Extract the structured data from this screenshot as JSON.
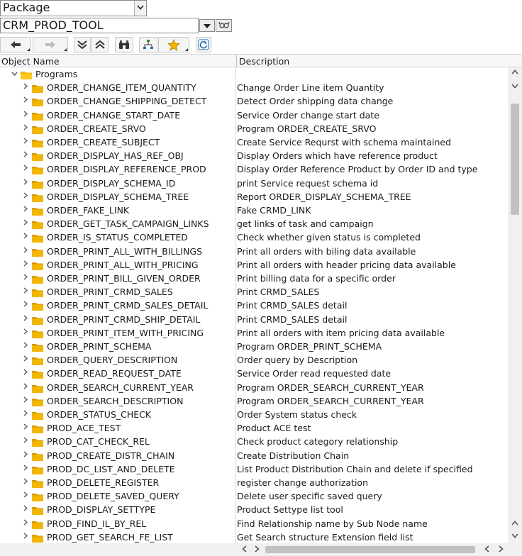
{
  "selector": {
    "type_value": "Package",
    "object_value": "CRM_PROD_TOOL"
  },
  "header": {
    "col1": "Object Name",
    "col2": "Description"
  },
  "tree": {
    "root": {
      "label": "Programs"
    },
    "items": [
      {
        "name": "ORDER_CHANGE_ITEM_QUANTITY",
        "desc": "Change Order Line item Quantity"
      },
      {
        "name": "ORDER_CHANGE_SHIPPING_DETECT",
        "desc": "Detect Order shipping data change"
      },
      {
        "name": "ORDER_CHANGE_START_DATE",
        "desc": "Service Order change start date"
      },
      {
        "name": "ORDER_CREATE_SRVO",
        "desc": "Program ORDER_CREATE_SRVO"
      },
      {
        "name": "ORDER_CREATE_SUBJECT",
        "desc": "Create Service Requrst with schema maintained"
      },
      {
        "name": "ORDER_DISPLAY_HAS_REF_OBJ",
        "desc": "Display Orders which have reference product"
      },
      {
        "name": "ORDER_DISPLAY_REFERENCE_PROD",
        "desc": "Display Order Reference Product by Order ID and type"
      },
      {
        "name": "ORDER_DISPLAY_SCHEMA_ID",
        "desc": "print Service request schema id"
      },
      {
        "name": "ORDER_DISPLAY_SCHEMA_TREE",
        "desc": "Report ORDER_DISPLAY_SCHEMA_TREE"
      },
      {
        "name": "ORDER_FAKE_LINK",
        "desc": "Fake CRMD_LINK"
      },
      {
        "name": "ORDER_GET_TASK_CAMPAIGN_LINKS",
        "desc": "get links of task and campaign"
      },
      {
        "name": "ORDER_IS_STATUS_COMPLETED",
        "desc": "Check whether given status is completed"
      },
      {
        "name": "ORDER_PRINT_ALL_WITH_BILLINGS",
        "desc": "Print all orders with biling data available"
      },
      {
        "name": "ORDER_PRINT_ALL_WITH_PRICING",
        "desc": "Print all orders with header pricing data available"
      },
      {
        "name": "ORDER_PRINT_BILL_GIVEN_ORDER",
        "desc": "Print billing data for a specific order"
      },
      {
        "name": "ORDER_PRINT_CRMD_SALES",
        "desc": "Print CRMD_SALES"
      },
      {
        "name": "ORDER_PRINT_CRMD_SALES_DETAIL",
        "desc": "Print CRMD_SALES detail"
      },
      {
        "name": "ORDER_PRINT_CRMD_SHIP_DETAIL",
        "desc": "Print CRMD_SALES detail"
      },
      {
        "name": "ORDER_PRINT_ITEM_WITH_PRICING",
        "desc": "Print all orders with item pricing data available"
      },
      {
        "name": "ORDER_PRINT_SCHEMA",
        "desc": "Program ORDER_PRINT_SCHEMA"
      },
      {
        "name": "ORDER_QUERY_DESCRIPTION",
        "desc": "Order query by Description"
      },
      {
        "name": "ORDER_READ_REQUEST_DATE",
        "desc": "Service Order read requested date"
      },
      {
        "name": "ORDER_SEARCH_CURRENT_YEAR",
        "desc": "Program ORDER_SEARCH_CURRENT_YEAR"
      },
      {
        "name": "ORDER_SEARCH_DESCRIPTION",
        "desc": "Program ORDER_SEARCH_CURRENT_YEAR"
      },
      {
        "name": "ORDER_STATUS_CHECK",
        "desc": "Order System status check"
      },
      {
        "name": "PROD_ACE_TEST",
        "desc": "Product ACE test"
      },
      {
        "name": "PROD_CAT_CHECK_REL",
        "desc": "Check product category relationship"
      },
      {
        "name": "PROD_CREATE_DISTR_CHAIN",
        "desc": "Create Distribution Chain"
      },
      {
        "name": "PROD_DC_LIST_AND_DELETE",
        "desc": "List Product Distribution Chain and delete if specified"
      },
      {
        "name": "PROD_DELETE_REGISTER",
        "desc": "register change authorization"
      },
      {
        "name": "PROD_DELETE_SAVED_QUERY",
        "desc": "Delete user specific saved query"
      },
      {
        "name": "PROD_DISPLAY_SETTYPE",
        "desc": "Product Settype list tool"
      },
      {
        "name": "PROD_FIND_IL_BY_REL",
        "desc": "Find Relationship name by Sub Node name"
      },
      {
        "name": "PROD_GET_SEARCH_FE_LIST",
        "desc": "Get Search structure Extension field list"
      }
    ]
  },
  "scroll": {
    "vertical_position": 0.12,
    "vertical_visible_fraction": 0.27
  },
  "colors": {
    "folder": "#f2b600",
    "folder_dark": "#d79a00",
    "nav_blue": "#1a6fb5"
  }
}
